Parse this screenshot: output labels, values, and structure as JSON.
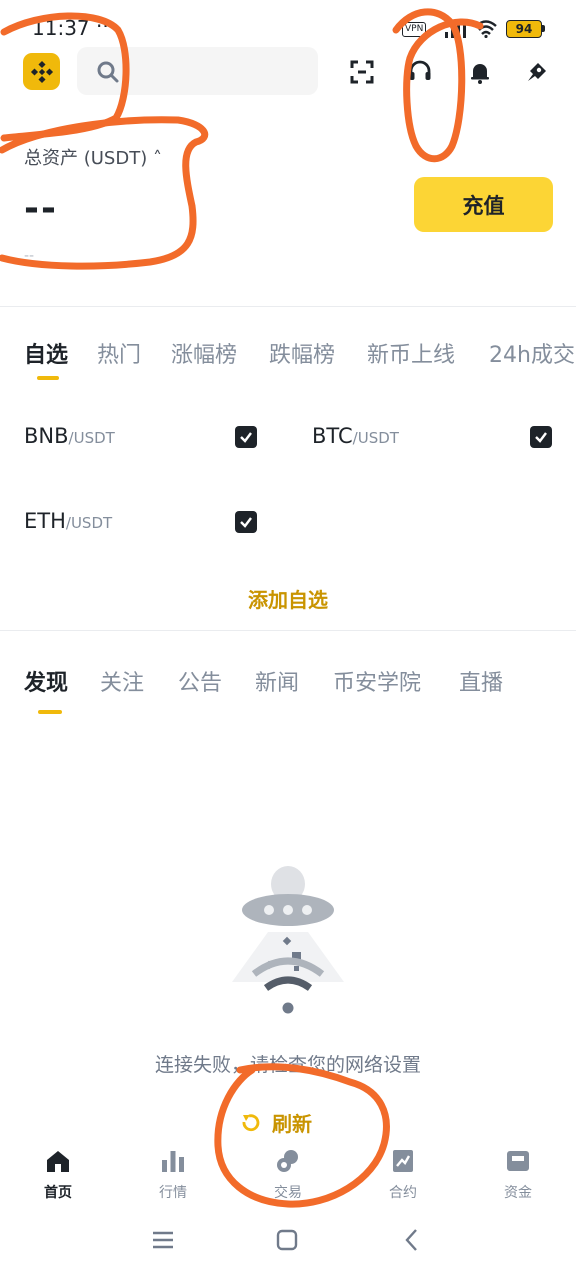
{
  "status_bar": {
    "time": "11:37",
    "overflow": "···",
    "vpn": "VPN",
    "battery": "94"
  },
  "header": {
    "search_placeholder": ""
  },
  "assets": {
    "label": "总资产 (USDT) ˄",
    "value": "--",
    "sub_value": "--",
    "deposit_label": "充值"
  },
  "market_tabs": [
    "自选",
    "热门",
    "涨幅榜",
    "跌幅榜",
    "新币上线",
    "24h成交"
  ],
  "watchlist": [
    {
      "base": "BNB",
      "quote": "/USDT",
      "checked": true
    },
    {
      "base": "BTC",
      "quote": "/USDT",
      "checked": true
    },
    {
      "base": "ETH",
      "quote": "/USDT",
      "checked": true
    }
  ],
  "add_watchlist_label": "添加自选",
  "feed_tabs": [
    "发现",
    "关注",
    "公告",
    "新闻",
    "币安学院",
    "直播"
  ],
  "empty_state": {
    "message": "连接失败，请检查您的网络设置",
    "refresh_label": "刷新"
  },
  "bottom_nav": [
    {
      "label": "首页",
      "icon": "home-icon"
    },
    {
      "label": "行情",
      "icon": "chart-icon"
    },
    {
      "label": "交易",
      "icon": "trade-icon"
    },
    {
      "label": "合约",
      "icon": "futures-icon"
    },
    {
      "label": "资金",
      "icon": "wallet-icon"
    }
  ],
  "colors": {
    "brand": "#f0b90b",
    "button": "#fcd535",
    "link": "#c99400",
    "annotation": "#f26b2a"
  }
}
